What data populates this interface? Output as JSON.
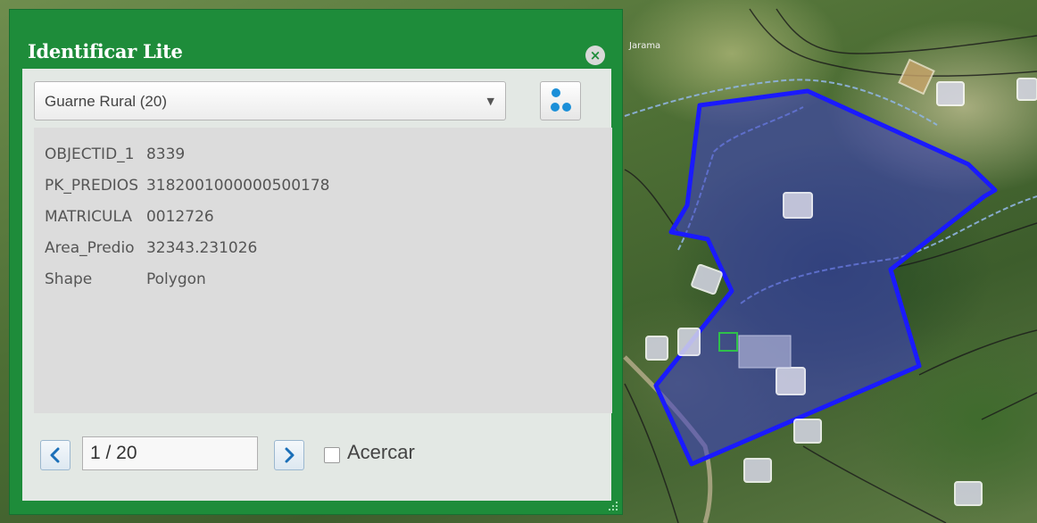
{
  "map": {
    "label": "Jarama",
    "colors": {
      "parcel_outline": "#1a1aff",
      "parcel_fill": "#3c3cc8",
      "stream": "#8fb4e0"
    }
  },
  "widget": {
    "title": "Identificar Lite",
    "close_icon": "×",
    "layer_select": {
      "value": "Guarne Rural (20)",
      "arrow": "▼"
    },
    "attributes": [
      {
        "key": "OBJECTID_1",
        "value": "8339"
      },
      {
        "key": "PK_PREDIOS",
        "value": "3182001000000500178"
      },
      {
        "key": "MATRICULA",
        "value": "0012726"
      },
      {
        "key": "Area_Predio",
        "value": "32343.231026"
      },
      {
        "key": "Shape",
        "value": "Polygon"
      }
    ],
    "pager": {
      "value": "1 / 20",
      "prev_icon": "chevron-left-icon",
      "next_icon": "chevron-right-icon"
    },
    "zoom_label": "Acercar",
    "zoom_checked": false
  },
  "colors": {
    "panel_green": "#1e8c3a",
    "accent_blue": "#1b8fd8"
  }
}
